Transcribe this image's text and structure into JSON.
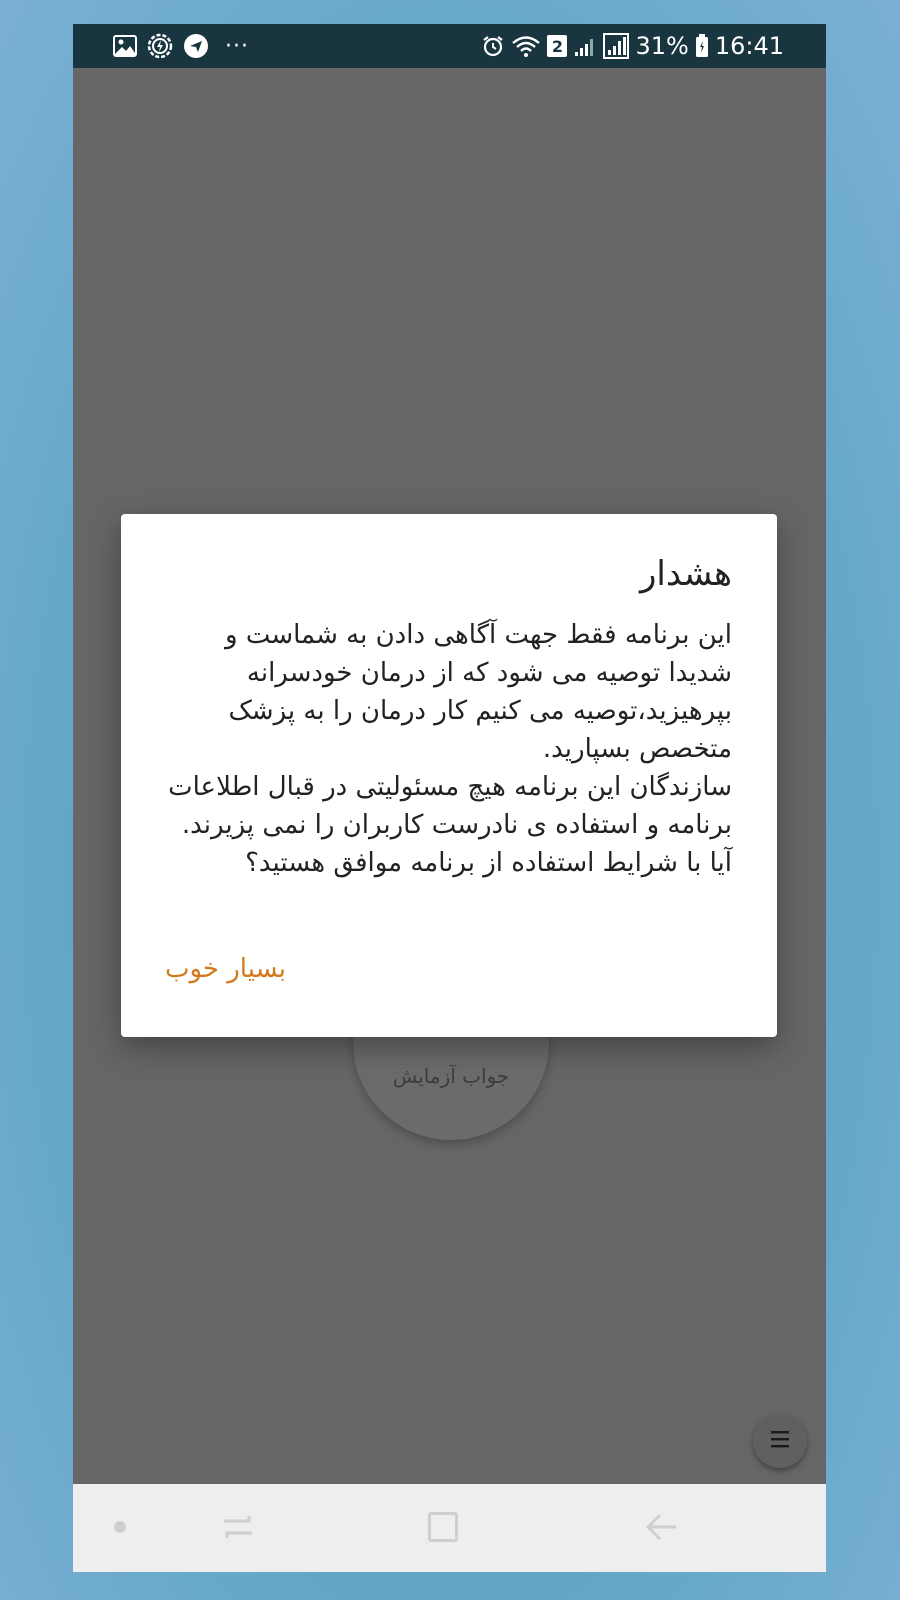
{
  "status_bar": {
    "time": "16:41",
    "battery_percent": "31%",
    "sim_badge": "2",
    "more_indicator": "···",
    "icons_left": [
      "gallery-icon",
      "data-saver-icon",
      "telegram-icon"
    ],
    "icons_right": [
      "alarm-icon",
      "wifi-icon",
      "sim-badge-icon",
      "signal-icon",
      "signal-icon",
      "battery-icon"
    ]
  },
  "background_screen": {
    "circle_button_label": "جواب آزمایش"
  },
  "dialog": {
    "title": "هشدار",
    "body": "این برنامه فقط جهت آگاهی دادن به شماست و شدیدا توصیه می شود که از درمان خودسرانه بپرهیزید،توصیه می کنیم کار درمان را به پزشک متخصص بسپارید.\n سازندگان این برنامه هیچ مسئولیتی در قبال اطلاعات برنامه و استفاده ی نادرست کاربران را نمی پزیرند.\n آیا با شرایط استفاده از برنامه موافق هستید؟",
    "ok_button": "بسیار خوب"
  },
  "colors": {
    "status_bar": "#193640",
    "scrim": "#666666",
    "dialog_bg": "#ffffff",
    "accent": "#d47a1e",
    "nav_bar": "#eeeeee"
  }
}
